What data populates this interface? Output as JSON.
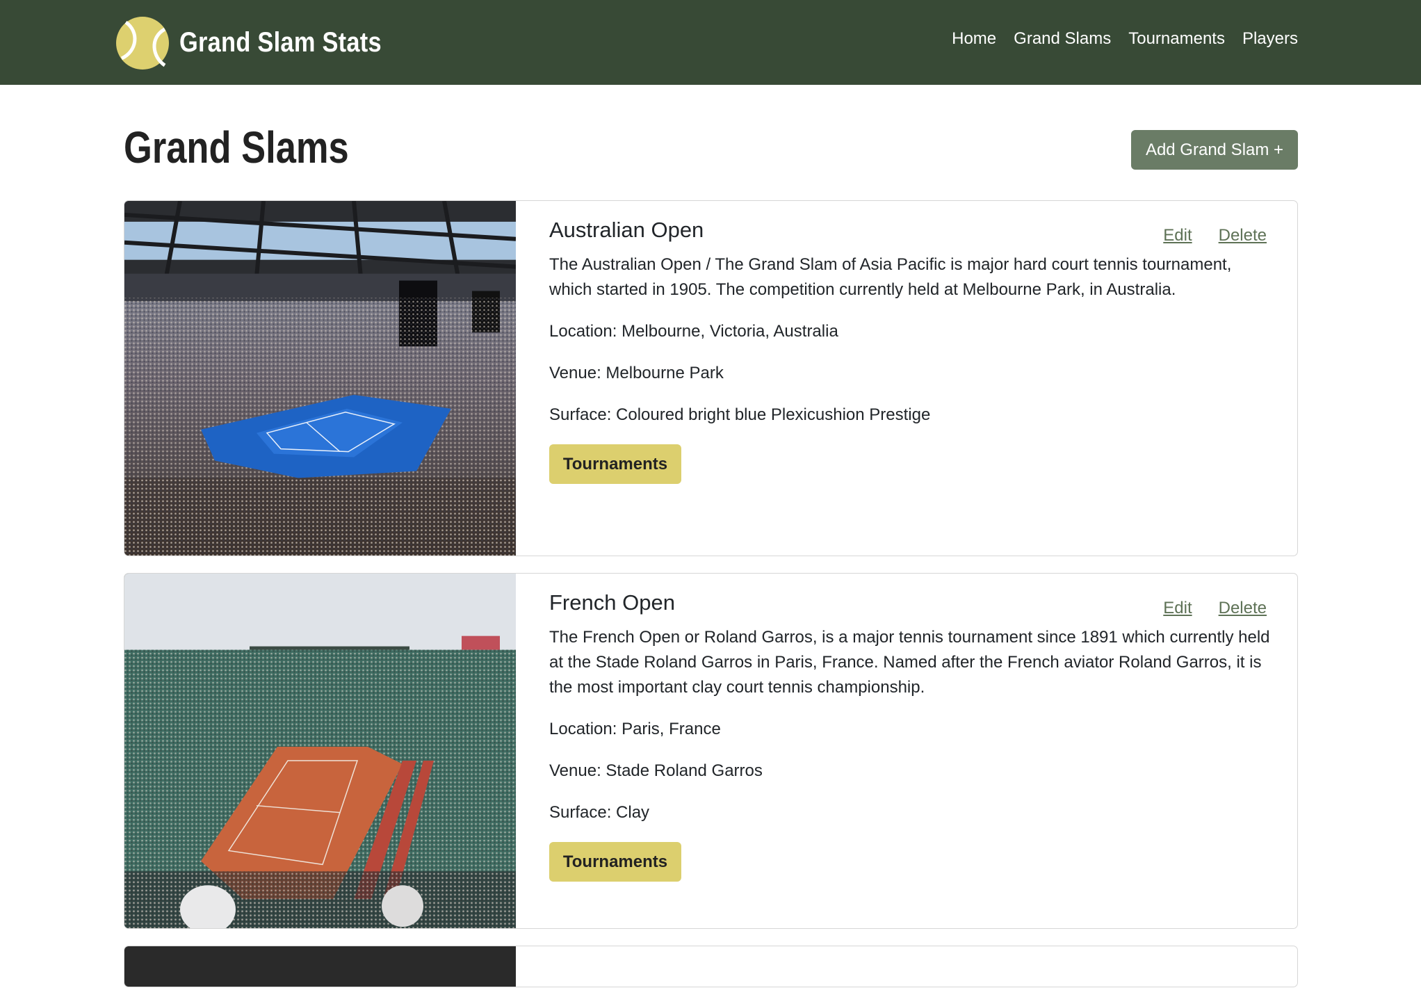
{
  "brand": {
    "name": "Grand Slam Stats",
    "logo_icon": "tennis-ball-icon",
    "logo_color": "#ddd06f"
  },
  "nav": {
    "items": [
      {
        "label": "Home"
      },
      {
        "label": "Grand Slams"
      },
      {
        "label": "Tournaments"
      },
      {
        "label": "Players"
      }
    ]
  },
  "page": {
    "title": "Grand Slams",
    "add_button_label": "Add Grand Slam +"
  },
  "colors": {
    "navbar": "#384a36",
    "primary_button": "#6a7c66",
    "tournaments_button": "#dccf6e",
    "link": "#5e7256"
  },
  "grand_slams": [
    {
      "name": "Australian Open",
      "edit_label": "Edit",
      "delete_label": "Delete",
      "description": "The Australian Open / The Grand Slam of Asia Pacific is major hard court tennis tournament, which started in 1905. The competition currently held at Melbourne Park, in Australia.",
      "location": "Location: Melbourne, Victoria, Australia",
      "venue": "Venue: Melbourne Park",
      "surface": "Surface: Coloured bright blue Plexicushion Prestige",
      "tournaments_label": "Tournaments",
      "image": "stadium-photo-blue-hard-court"
    },
    {
      "name": "French Open",
      "edit_label": "Edit",
      "delete_label": "Delete",
      "description": "The French Open or Roland Garros, is a major tennis tournament since 1891 which currently held at the Stade Roland Garros in Paris, France. Named after the French aviator Roland Garros, it is the most important clay court tennis championship.",
      "location": "Location: Paris, France",
      "venue": "Venue: Stade Roland Garros",
      "surface": "Surface: Clay",
      "tournaments_label": "Tournaments",
      "image": "stadium-photo-clay-court"
    }
  ]
}
